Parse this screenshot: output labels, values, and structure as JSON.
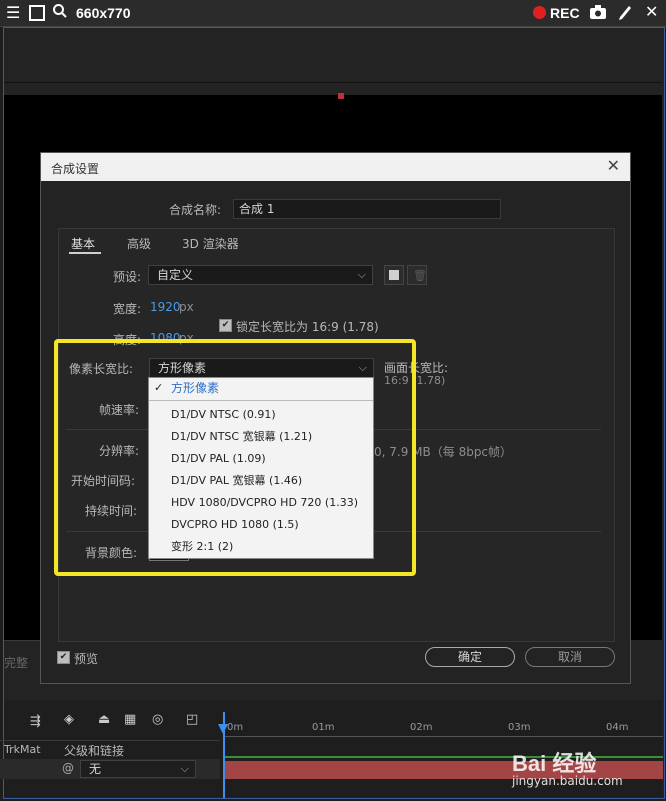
{
  "recorder": {
    "size_label": "660x770",
    "rec_label": "REC",
    "icons": [
      "menu-icon",
      "window-icon",
      "search-icon",
      "record-dot-icon",
      "camera-icon",
      "pen-icon",
      "close-icon"
    ]
  },
  "dialog": {
    "title": "合成设置",
    "name_label": "合成名称:",
    "name_value": "合成 1",
    "tabs": [
      "基本",
      "高级",
      "3D 渲染器"
    ],
    "preset_label": "预设:",
    "preset_value": "自定义",
    "width_label": "宽度:",
    "width_value": "1920",
    "height_label": "高度:",
    "height_value": "1080",
    "unit_px": "px",
    "lock_ratio_label": "锁定长宽比为 16:9 (1.78)",
    "pixel_aspect_label": "像素长宽比:",
    "pixel_aspect_value": "方形像素",
    "frame_aspect_label": "画面长宽比:",
    "frame_aspect_value": "16:9 (1.78)",
    "frame_rate_label": "帧速率:",
    "resolution_label": "分辨率:",
    "resolution_info": "0, 7.9 MB（每 8bpc帧）",
    "start_timecode_label": "开始时间码:",
    "duration_label": "持续时间:",
    "bg_color_label": "背景颜色:",
    "preview_label": "预览",
    "ok_label": "确定",
    "cancel_label": "取消"
  },
  "dropdown": {
    "selected": "方形像素",
    "items": [
      "D1/DV NTSC (0.91)",
      "D1/DV NTSC 宽银幕 (1.21)",
      "D1/DV PAL (1.09)",
      "D1/DV PAL 宽银幕 (1.46)",
      "HDV 1080/DVCPRO HD 720 (1.33)",
      "DVCPRO HD 1080 (1.5)",
      "变形 2:1 (2)"
    ]
  },
  "panel_left_label": "完整",
  "timeline": {
    "ticks": [
      "0m",
      "01m",
      "02m",
      "03m",
      "04m"
    ],
    "trkmat_label": "TrkMat",
    "parent_label": "父级和链接",
    "parent_value": "无"
  },
  "watermark": {
    "brand": "Bai 经验",
    "url": "jingyan.baidu.com"
  },
  "colors": {
    "highlight": "#f4e526",
    "accent_blue": "#4a9be8",
    "rec_red": "#e02020",
    "layer_red": "#a34545"
  }
}
